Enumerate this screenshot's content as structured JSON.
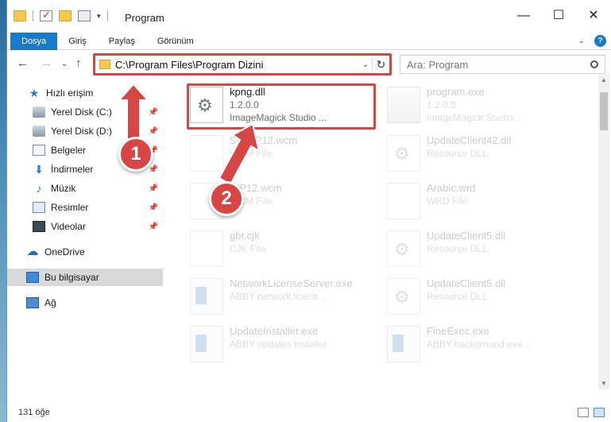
{
  "window": {
    "title": "Program",
    "controls": [
      "—",
      "☐",
      "✕"
    ]
  },
  "ribbon": {
    "tabs": [
      "Dosya",
      "Giriş",
      "Paylaş",
      "Görünüm"
    ],
    "help": "?"
  },
  "nav": {
    "address": "C:\\Program Files\\Program Dizini",
    "search_placeholder": "Ara: Program"
  },
  "sidebar": {
    "items": [
      {
        "label": "Hızlı erişim",
        "icon": "star-icon"
      },
      {
        "label": "Yerel Disk (C:)",
        "icon": "disk-icon",
        "pinned": true
      },
      {
        "label": "Yerel Disk (D:)",
        "icon": "disk-icon",
        "pinned": true
      },
      {
        "label": "Belgeler",
        "icon": "documents-icon",
        "pinned": true
      },
      {
        "label": "İndirmeler",
        "icon": "downloads-icon",
        "pinned": true
      },
      {
        "label": "Müzik",
        "icon": "music-icon",
        "pinned": true
      },
      {
        "label": "Resimler",
        "icon": "pictures-icon",
        "pinned": true
      },
      {
        "label": "Videolar",
        "icon": "videos-icon",
        "pinned": true
      },
      {
        "label": "OneDrive",
        "icon": "onedrive-icon"
      },
      {
        "label": "Bu bilgisayar",
        "icon": "this-pc-icon",
        "selected": true
      },
      {
        "label": "Ağ",
        "icon": "network-icon"
      }
    ]
  },
  "files": [
    {
      "name": "kpng.dll",
      "line2": "1.2.0.0",
      "line3": "ImageMagick Studio ...",
      "icon": "dll-gear-icon",
      "highlighted": true
    },
    {
      "name": "program.exe",
      "line2": "1.2.0.0",
      "line3": "ImageMagick Studio ...",
      "icon": "exe-icon"
    },
    {
      "name": "SmWP12.wcm",
      "line2": "WCM File",
      "line3": "",
      "icon": "blank-file-icon"
    },
    {
      "name": "UpdateClient42.dll",
      "line2": "Resource DLL",
      "line3": "",
      "icon": "dll-gear-icon"
    },
    {
      "name": "WP12.wcm",
      "line2": "WCM File",
      "line3": "",
      "icon": "blank-file-icon"
    },
    {
      "name": "Arabic.wrd",
      "line2": "WRD File",
      "line3": "",
      "icon": "blank-file-icon"
    },
    {
      "name": "gbt.cjk",
      "line2": "CJK File",
      "line3": "",
      "icon": "blank-file-icon"
    },
    {
      "name": "UpdateClient5.dll",
      "line2": "Resource DLL",
      "line3": "",
      "icon": "dll-gear-icon"
    },
    {
      "name": "NetworkLicenseServer.exe",
      "line2": "ABBY network licens...",
      "line3": "",
      "icon": "app-icon"
    },
    {
      "name": "UpdateClient5.dll",
      "line2": "Resource DLL",
      "line3": "",
      "icon": "dll-gear-icon"
    },
    {
      "name": "UpdateInstaller.exe",
      "line2": "ABBY updates installer",
      "line3": "",
      "icon": "app-icon"
    },
    {
      "name": "FineExec.exe",
      "line2": "ABBY background exe...",
      "line3": "",
      "icon": "app-icon"
    }
  ],
  "status": {
    "item_count": "131 öğe"
  },
  "callouts": [
    "1",
    "2"
  ],
  "colors": {
    "accent": "#1979ca",
    "highlight_red": "#d84545"
  }
}
